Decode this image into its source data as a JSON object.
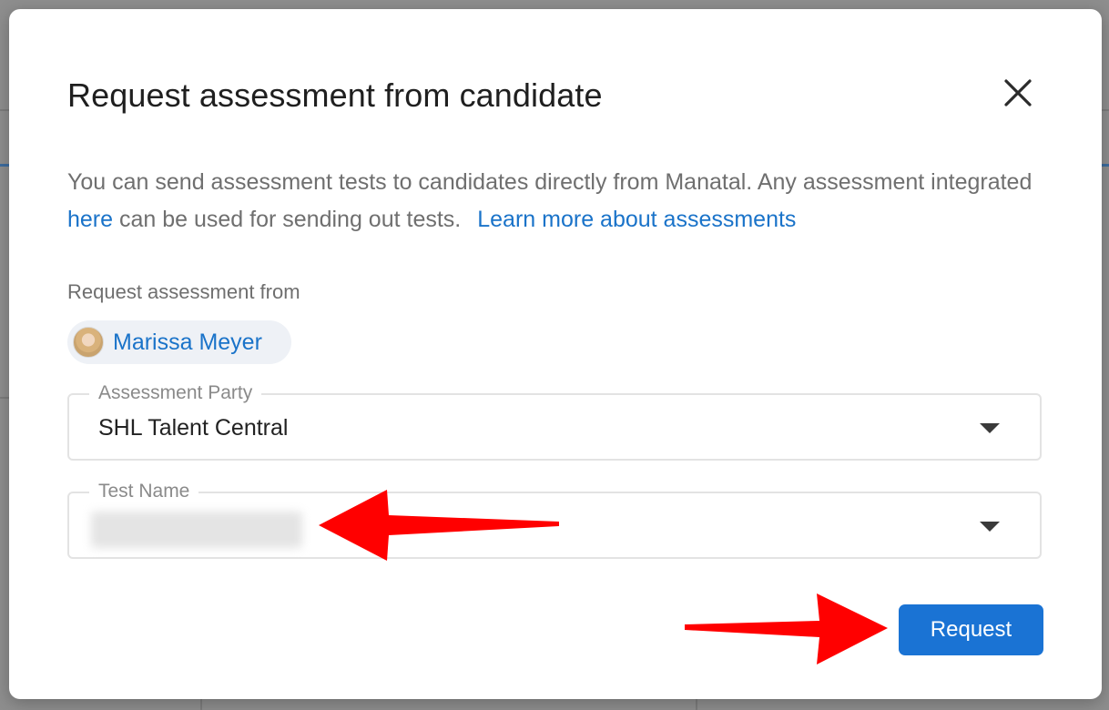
{
  "modal": {
    "title": "Request assessment from candidate",
    "close_icon": "close-icon",
    "description": {
      "part1": "You can send assessment tests to candidates directly from Manatal. Any assessment integrated ",
      "here_link": "here",
      "part2": " can be used for sending out tests.",
      "learn_more_link": "Learn more about assessments"
    },
    "request_from_label": "Request assessment from",
    "candidate": {
      "name": "Marissa Meyer",
      "avatar_icon": "avatar"
    },
    "assessment_party": {
      "label": "Assessment Party",
      "value": "SHL Talent Central",
      "dropdown_icon": "caret-down-icon"
    },
    "test_name": {
      "label": "Test Name",
      "value_obscured": true,
      "dropdown_icon": "caret-down-icon"
    },
    "request_button": "Request"
  },
  "annotations": {
    "arrow_color": "#ff0000",
    "count": 2
  },
  "colors": {
    "accent": "#1a73d4",
    "link": "#1a73c9",
    "overlay": "#8e8e8e"
  }
}
